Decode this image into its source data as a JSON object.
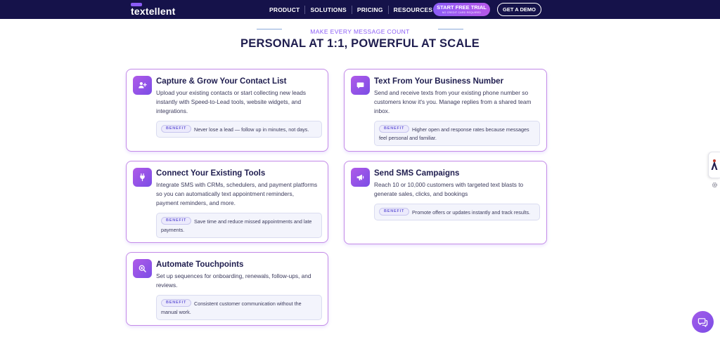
{
  "nav": {
    "logo": "textellent",
    "menu": [
      "PRODUCT",
      "SOLUTIONS",
      "PRICING",
      "RESOURCES"
    ],
    "trial_button": "START FREE TRIAL",
    "trial_subtext": "NO CREDIT CARD REQUIRED",
    "demo_button": "GET A DEMO"
  },
  "section": {
    "eyebrow": "MAKE EVERY MESSAGE COUNT",
    "headline": "PERSONAL AT 1:1, POWERFUL AT SCALE"
  },
  "cards": [
    {
      "icon": "add-user-icon",
      "title": "Capture & Grow Your Contact List",
      "desc_lines": [
        "Upload your existing contacts or start collecting new leads",
        "instantly with Speed-to-Lead tools, website widgets, and",
        "integrations."
      ],
      "benefit_label": "BENEFIT",
      "benefit_lines": [
        "Never lose a lead — follow up in minutes, not days."
      ]
    },
    {
      "icon": "message-icon",
      "title": "Text From Your Business Number",
      "desc_lines": [
        "Send and receive texts from your existing phone number so",
        "customers know it's you. Manage replies from a shared team",
        "inbox."
      ],
      "benefit_label": "BENEFIT",
      "benefit_lines": [
        "Higher open and response rates because messages",
        "feel personal and familiar."
      ]
    },
    {
      "icon": "plug-icon",
      "title": "Connect Your Existing Tools",
      "desc_lines": [
        "Integrate SMS with CRMs, schedulers, and payment platforms",
        "so you can automatically text appointment reminders,",
        "payment reminders, and more."
      ],
      "benefit_label": "BENEFIT",
      "benefit_lines": [
        "Save time and reduce missed appointments and late",
        "payments."
      ]
    },
    {
      "icon": "megaphone-icon",
      "title": "Send SMS Campaigns",
      "desc_lines": [
        "Reach 10 or 10,000 customers with targeted text blasts to",
        "generate sales, clicks, and bookings"
      ],
      "benefit_label": "BENEFIT",
      "benefit_lines": [
        "Promote offers or updates instantly and track results."
      ]
    },
    {
      "icon": "touchpoint-icon",
      "title": "Automate Touchpoints",
      "desc_lines": [
        "Set up sequences for onboarding, renewals, follow-ups, and",
        "reviews."
      ],
      "benefit_label": "BENEFIT",
      "benefit_lines": [
        "Consistent customer communication without the",
        "manual work."
      ]
    }
  ],
  "colors": {
    "nav_bg": "#15124a",
    "accent": "#8b5cf6",
    "card_border": "#c48be8",
    "heading": "#1f1d4f"
  },
  "widgets": {
    "side_icon": "accessibility-icon",
    "gear_icon": "gear-icon",
    "chat_icon": "chat-icon"
  }
}
